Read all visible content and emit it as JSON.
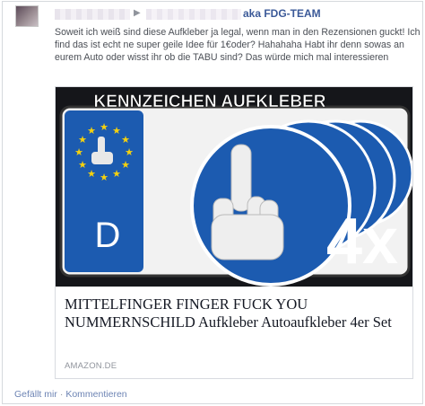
{
  "post": {
    "target_name": "aka FDG-TEAM",
    "arrow_icon": "▶",
    "text": "Soweit ich weiß sind diese Aufkleber ja legal, wenn man in den Rezensionen guckt! Ich find das ist echt ne super geile Idee für 1€oder? Hahahaha Habt ihr denn sowas an eurem Auto oder wisst ihr ob die TABU sind? Das würde mich mal interessieren"
  },
  "link_card": {
    "image_banner": "KENNZEICHEN AUFKLEBER",
    "image_country_letter": "D",
    "image_quantity": "4x",
    "title": "MITTELFINGER FINGER FUCK YOU NUMMERNSCHILD Aufkleber Autoaufkleber 4er Set",
    "domain": "AMAZON.DE"
  },
  "actions": {
    "like": "Gefällt mir",
    "separator": "·",
    "comment": "Kommentieren"
  },
  "colors": {
    "link_blue": "#3b5998",
    "plate_blue": "#1c5bb0",
    "euro_yellow": "#f5d10e"
  }
}
